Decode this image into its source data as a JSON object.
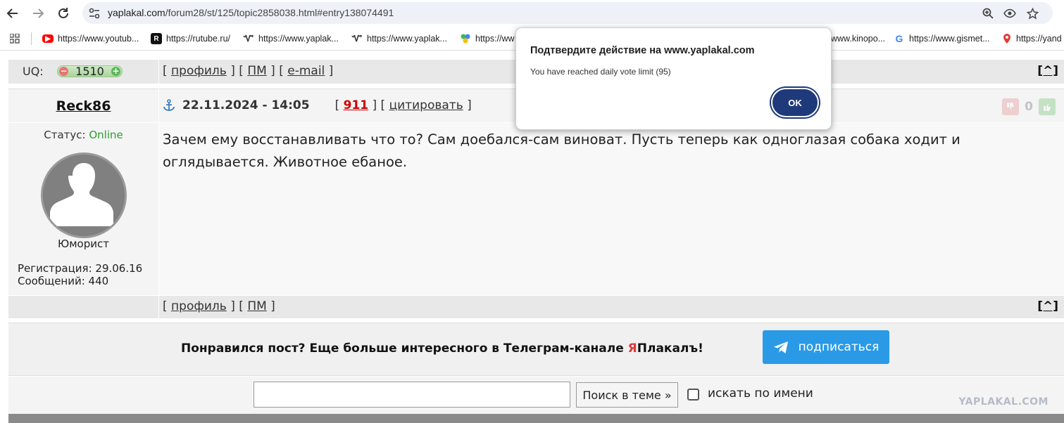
{
  "browser": {
    "url_host": "yaplakal.com",
    "url_path": "/forum28/st/125/topic2858038.html#entry138074491",
    "bookmarks": [
      {
        "label": "https://www.youtub...",
        "icon": "youtube-icon",
        "color": "#ff0000"
      },
      {
        "label": "https://rutube.ru/",
        "icon": "rutube-icon",
        "color": "#111111"
      },
      {
        "label": "https://www.yaplak...",
        "icon": "yaplakal-icon",
        "color": "#333333"
      },
      {
        "label": "https://www.yaplak...",
        "icon": "yaplakal-icon",
        "color": "#333333"
      },
      {
        "label": "https://ww",
        "icon": "colorful-dots-icon",
        "color": "#3cba54"
      },
      {
        "label": "www.kinopo...",
        "icon": "kinopoisk-icon",
        "color": "#ff6600"
      },
      {
        "label": "https://www.gismet...",
        "icon": "g-letter-icon",
        "color": "#4285f4"
      },
      {
        "label": "https://yand",
        "icon": "map-pin-icon",
        "color": "#e53935"
      }
    ]
  },
  "forum": {
    "uq_label": "UQ:",
    "uq_value": "1510",
    "top_links": [
      "профиль",
      "ПМ",
      "e-mail"
    ],
    "top_anchor": "[^]",
    "post": {
      "author": "Reck86",
      "date": "22.11.2024 - 14:05",
      "number": "911",
      "quote_label": "цитировать",
      "vote_count": "0",
      "status_label": "Статус:",
      "status_value": "Online",
      "rank": "Юморист",
      "registration": "Регистрация: 29.06.16",
      "messages": "Сообщений: 440",
      "text": "Зачем ему восстанавливать что то? Сам доебался-сам виноват. Пусть теперь как одноглазая собака ходит и оглядывается. Животное ебаное."
    },
    "bottom_links": [
      "профиль",
      "ПМ"
    ],
    "bottom_anchor": "[^]"
  },
  "promo": {
    "text_before": "Понравился пост? Еще больше интересного в Телеграм-канале ",
    "brand_first": "Я",
    "brand_rest": "Плакалъ!",
    "button_label": "подписаться"
  },
  "search": {
    "input_value": "",
    "button_label": "Поиск в теме »",
    "checkbox_label": "искать по имени",
    "checkbox_checked": false,
    "watermark": "YAPLAKAL.COM"
  },
  "dialog": {
    "title": "Подтвердите действие на www.yaplakal.com",
    "message": "You have reached daily vote limit (95)",
    "ok_label": "OK"
  },
  "colors": {
    "accent_link": "#cc0000",
    "online": "#2c9e2c",
    "telegram": "#2a9ae6",
    "ok_button": "#1e3a7a"
  }
}
